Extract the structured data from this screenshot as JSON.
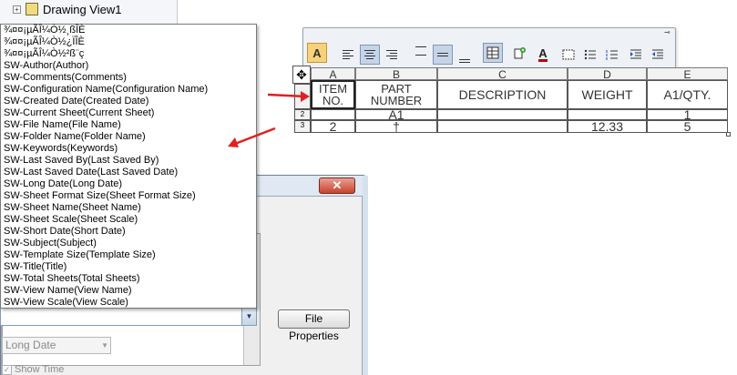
{
  "tree": {
    "node_label": "Drawing View1"
  },
  "dropdown": {
    "items": [
      "¾¤¤¡µÃÎ¼Ò½¸ßÎÈ",
      "¾¤¤¡µÃÎ¼Ò½¿ÏÎÈ",
      "¾¤¤¡µÃÎ¼Ò½²ß¨ç",
      "SW-Author(Author)",
      "SW-Comments(Comments)",
      "SW-Configuration Name(Configuration Name)",
      "SW-Created Date(Created Date)",
      "SW-Current Sheet(Current Sheet)",
      "SW-File Name(File Name)",
      "SW-Folder Name(Folder Name)",
      "SW-Keywords(Keywords)",
      "SW-Last Saved By(Last Saved By)",
      "SW-Last Saved Date(Last Saved Date)",
      "SW-Long Date(Long Date)",
      "SW-Sheet Format Size(Sheet Format Size)",
      "SW-Sheet Name(Sheet Name)",
      "SW-Sheet Scale(Sheet Scale)",
      "SW-Short Date(Short Date)",
      "SW-Subject(Subject)",
      "SW-Template Size(Template Size)",
      "SW-Title(Title)",
      "SW-Total Sheets(Total Sheets)",
      "SW-View Name(View Name)",
      "SW-View Scale(View Scale)"
    ]
  },
  "dialog": {
    "close_label": "✕",
    "file_properties_label": "File Properties",
    "date_format_value": "Long Date",
    "show_time_label": "Show Time"
  },
  "table": {
    "columns": [
      "A",
      "B",
      "C",
      "D",
      "E"
    ],
    "row_numbers": [
      "1",
      "2",
      "3"
    ],
    "header": [
      "ITEM\nNO.",
      "PART\nNUMBER",
      "DESCRIPTION",
      "WEIGHT",
      "A1/QTY."
    ],
    "row2": [
      "",
      "A1",
      "",
      "",
      "1"
    ],
    "row3": [
      "2",
      "†",
      "",
      "12.33",
      "5"
    ]
  },
  "toolbar": {
    "font_button": "A",
    "font_color_label": "A",
    "pin_glyph": "⊸"
  },
  "colors": {
    "arrow": "#e02020"
  }
}
